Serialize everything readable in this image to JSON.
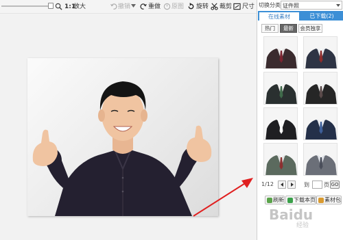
{
  "toolbar": {
    "ratio_label": "1:1",
    "enlarge_label": "放大",
    "undo_label": "撤销",
    "redo_label": "重做",
    "original_label": "原图",
    "rotate_label": "旋转",
    "crop_label": "裁剪",
    "size_label": "尺寸"
  },
  "sidebar": {
    "category_label": "切换分类",
    "category_value": "证件照",
    "tabs": [
      {
        "label": "在线素材",
        "active": true
      },
      {
        "label": "已下载(2)",
        "active": false
      }
    ],
    "subtabs": [
      {
        "label": "热门",
        "active": false
      },
      {
        "label": "最新",
        "active": true
      },
      {
        "label": "会员独享",
        "active": false
      }
    ],
    "thumbnails": [
      {
        "name": "dark-suit-red-tie",
        "suit": "#3a2b2e",
        "tie": "#7a2430",
        "shirt": "#e8e4e4"
      },
      {
        "name": "navy-suit-striped-tie",
        "suit": "#2e3444",
        "tie": "#8c2c2c",
        "shirt": "#e9ecef"
      },
      {
        "name": "dark-suit-green-tie",
        "suit": "#2a3030",
        "tie": "#3f6a4a",
        "shirt": "#f0f0ee"
      },
      {
        "name": "black-suit-collar",
        "suit": "#262626",
        "tie": "#5a4a4a",
        "shirt": "#eeeeee"
      },
      {
        "name": "black-jacket-open",
        "suit": "#1f1f22",
        "tie": "#f7f7f7",
        "shirt": "#ffffff"
      },
      {
        "name": "navy-suit-blue-tie",
        "suit": "#243049",
        "tie": "#3d5f9a",
        "shirt": "#e7eaf0"
      },
      {
        "name": "grey-green-suit",
        "suit": "#5b6a5e",
        "tie": "#8c3030",
        "shirt": "#e6e6e6"
      },
      {
        "name": "grey-suit-stripe",
        "suit": "#6b6f78",
        "tie": "#4a4e5a",
        "shirt": "#dfe2e8"
      }
    ],
    "pager": {
      "page_info": "1/12",
      "goto_label": "到",
      "page_unit": "页",
      "go_label": "GO",
      "page_value": ""
    },
    "actions": {
      "refresh_label": "刷新",
      "download_page_label": "下载本页",
      "package_label": "素材包"
    }
  },
  "watermark": {
    "brand": "Baidu",
    "sub": "经验"
  },
  "colors": {
    "accent": "#3c8fd6",
    "arrow": "#e02020"
  }
}
